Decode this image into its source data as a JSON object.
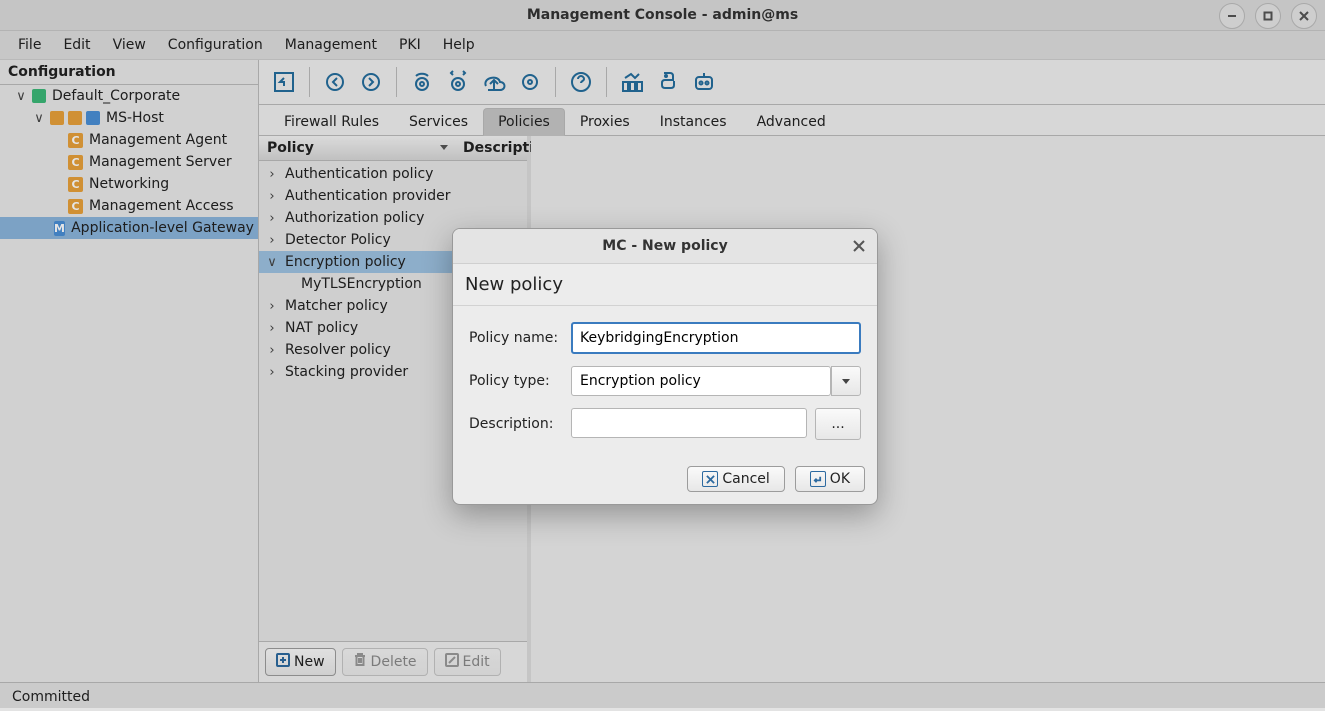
{
  "window": {
    "title": "Management Console - admin@ms"
  },
  "menu": [
    "File",
    "Edit",
    "View",
    "Configuration",
    "Management",
    "PKI",
    "Help"
  ],
  "sidebar": {
    "header": "Configuration",
    "tree": [
      {
        "label": "Default_Corporate",
        "depth": 0,
        "expander": "∨",
        "icons": [
          "green"
        ]
      },
      {
        "label": "MS-Host",
        "depth": 1,
        "expander": "∨",
        "icons": [
          "orange",
          "orange",
          "blue"
        ]
      },
      {
        "label": "Management Agent",
        "depth": 2,
        "expander": "",
        "letter": "C"
      },
      {
        "label": "Management Server",
        "depth": 2,
        "expander": "",
        "letter": "C"
      },
      {
        "label": "Networking",
        "depth": 2,
        "expander": "",
        "letter": "C"
      },
      {
        "label": "Management Access",
        "depth": 2,
        "expander": "",
        "letter": "C"
      },
      {
        "label": "Application-level Gateway",
        "depth": 2,
        "expander": "",
        "letter": "M",
        "selected": true
      }
    ]
  },
  "tabs": [
    "Firewall Rules",
    "Services",
    "Policies",
    "Proxies",
    "Instances",
    "Advanced"
  ],
  "active_tab": 2,
  "policy_panel": {
    "col1": "Policy",
    "col2": "Description",
    "items": [
      {
        "label": "Authentication policy",
        "expander": ""
      },
      {
        "label": "Authentication provider",
        "expander": ""
      },
      {
        "label": "Authorization policy",
        "expander": ""
      },
      {
        "label": "Detector Policy",
        "expander": ""
      },
      {
        "label": "Encryption policy",
        "expander": "∨",
        "selected": true
      },
      {
        "label": "MyTLSEncryption",
        "sub": true
      },
      {
        "label": "Matcher policy",
        "expander": ""
      },
      {
        "label": "NAT policy",
        "expander": ""
      },
      {
        "label": "Resolver policy",
        "expander": ""
      },
      {
        "label": "Stacking provider",
        "expander": ""
      }
    ],
    "buttons": {
      "new": "New",
      "delete": "Delete",
      "edit": "Edit"
    }
  },
  "dialog": {
    "title": "MC - New policy",
    "heading": "New policy",
    "fields": {
      "name_label": "Policy name:",
      "name_value": "KeybridgingEncryption",
      "type_label": "Policy type:",
      "type_value": "Encryption policy",
      "desc_label": "Description:",
      "desc_value": ""
    },
    "buttons": {
      "cancel": "Cancel",
      "ok": "OK",
      "dots": "..."
    }
  },
  "status": "Committed"
}
